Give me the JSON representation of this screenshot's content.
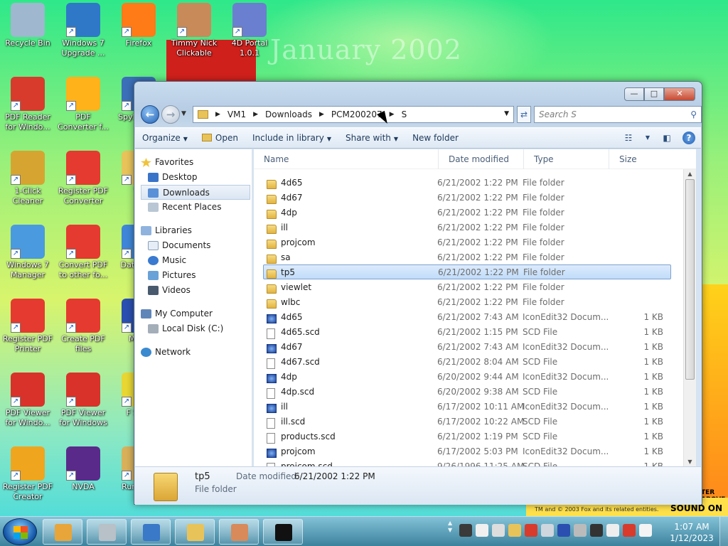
{
  "desktop": {
    "wallpaper_title": "January 2002",
    "icons": [
      {
        "label": "Recycle Bin",
        "icon": "recycle-bin-icon",
        "color": "#9fb7cf"
      },
      {
        "label": "Windows 7 Upgrade ...",
        "icon": "windows-upgrade-icon",
        "color": "#2f78c8"
      },
      {
        "label": "Firefox",
        "icon": "firefox-icon",
        "color": "#ff7b18"
      },
      {
        "label": "Timmy Nick Clickable",
        "icon": "cartoon-character-icon",
        "color": "#c98a5a"
      },
      {
        "label": "4D Portal 1.0.1",
        "icon": "4d-portal-icon",
        "color": "#6b7fd0"
      },
      {
        "label": "PDF Reader for Windo...",
        "icon": "pdf-reader-icon",
        "color": "#d83b2c"
      },
      {
        "label": "PDF Converter f...",
        "icon": "pdf-converter-icon",
        "color": "#ffb21a"
      },
      {
        "label": "Spyb Start",
        "icon": "spybot-icon",
        "color": "#3b6fb8"
      },
      {
        "label": "1-Click Cleaner",
        "icon": "cleaner-icon",
        "color": "#d6a531"
      },
      {
        "label": "Register PDF Converter",
        "icon": "chrome-icon",
        "color": "#e53a2f"
      },
      {
        "label": "Wi",
        "icon": "folder-icon",
        "color": "#e8c35a"
      },
      {
        "label": "Windows 7 Manager",
        "icon": "windows-manager-icon",
        "color": "#4a9ae0"
      },
      {
        "label": "Convert PDF to other fo...",
        "icon": "chrome-icon",
        "color": "#e53a2f"
      },
      {
        "label": "Dat Wind",
        "icon": "data-icon",
        "color": "#3f86d8"
      },
      {
        "label": "Register PDF Printer",
        "icon": "chrome-icon",
        "color": "#e53a2f"
      },
      {
        "label": "Create PDF files",
        "icon": "chrome-icon",
        "color": "#e53a2f"
      },
      {
        "label": "Malw",
        "icon": "malwarebytes-icon",
        "color": "#2a4fb0"
      },
      {
        "label": "PDF Viewer for Windo...",
        "icon": "pdf-viewer-icon",
        "color": "#d8322a"
      },
      {
        "label": "PDF Viewer for Windows",
        "icon": "pdf-viewer-icon",
        "color": "#d8322a"
      },
      {
        "label": "F Spor",
        "icon": "sponge-icon",
        "color": "#e8d632"
      },
      {
        "label": "Register PDF Creator",
        "icon": "cart-icon",
        "color": "#f0a51e"
      },
      {
        "label": "NVDA",
        "icon": "nvda-icon",
        "color": "#5a2a8a"
      },
      {
        "label": "Run Cott",
        "icon": "run-icon",
        "color": "#d9b05a"
      }
    ],
    "wallpaper_footer": "TM and © 2003 Fox and its related entities.",
    "wallpaper_sound": "SOUND ON",
    "wallpaper_side": "TER ABOVE"
  },
  "window": {
    "caption_buttons": {
      "minimize": "—",
      "maximize": "□",
      "close": "✕"
    },
    "address": {
      "segments": [
        "VM1",
        "Downloads",
        "PCM200207",
        "S"
      ]
    },
    "search_placeholder": "Search S",
    "toolbar": {
      "organize": "Organize",
      "open": "Open",
      "include": "Include in library",
      "share": "Share with",
      "new_folder": "New folder"
    },
    "nav": {
      "favorites": "Favorites",
      "desktop": "Desktop",
      "downloads": "Downloads",
      "recent": "Recent Places",
      "libraries": "Libraries",
      "documents": "Documents",
      "music": "Music",
      "pictures": "Pictures",
      "videos": "Videos",
      "computer": "My Computer",
      "local_disk": "Local Disk (C:)",
      "network": "Network"
    },
    "columns": {
      "name": "Name",
      "date": "Date modified",
      "type": "Type",
      "size": "Size"
    },
    "files": [
      {
        "name": "4d65",
        "date": "6/21/2002 1:22 PM",
        "type": "File folder",
        "size": "",
        "kind": "folder"
      },
      {
        "name": "4d67",
        "date": "6/21/2002 1:22 PM",
        "type": "File folder",
        "size": "",
        "kind": "folder"
      },
      {
        "name": "4dp",
        "date": "6/21/2002 1:22 PM",
        "type": "File folder",
        "size": "",
        "kind": "folder"
      },
      {
        "name": "ill",
        "date": "6/21/2002 1:22 PM",
        "type": "File folder",
        "size": "",
        "kind": "folder"
      },
      {
        "name": "projcom",
        "date": "6/21/2002 1:22 PM",
        "type": "File folder",
        "size": "",
        "kind": "folder"
      },
      {
        "name": "sa",
        "date": "6/21/2002 1:22 PM",
        "type": "File folder",
        "size": "",
        "kind": "folder"
      },
      {
        "name": "tp5",
        "date": "6/21/2002 1:22 PM",
        "type": "File folder",
        "size": "",
        "kind": "folder"
      },
      {
        "name": "viewlet",
        "date": "6/21/2002 1:22 PM",
        "type": "File folder",
        "size": "",
        "kind": "folder"
      },
      {
        "name": "wlbc",
        "date": "6/21/2002 1:22 PM",
        "type": "File folder",
        "size": "",
        "kind": "folder"
      },
      {
        "name": "4d65",
        "date": "6/21/2002 7:43 AM",
        "type": "IconEdit32 Docum...",
        "size": "1 KB",
        "kind": "icon"
      },
      {
        "name": "4d65.scd",
        "date": "6/21/2002 1:15 PM",
        "type": "SCD File",
        "size": "1 KB",
        "kind": "doc"
      },
      {
        "name": "4d67",
        "date": "6/21/2002 7:43 AM",
        "type": "IconEdit32 Docum...",
        "size": "1 KB",
        "kind": "icon"
      },
      {
        "name": "4d67.scd",
        "date": "6/21/2002 8:04 AM",
        "type": "SCD File",
        "size": "1 KB",
        "kind": "doc"
      },
      {
        "name": "4dp",
        "date": "6/20/2002 9:44 AM",
        "type": "IconEdit32 Docum...",
        "size": "1 KB",
        "kind": "icon"
      },
      {
        "name": "4dp.scd",
        "date": "6/20/2002 9:38 AM",
        "type": "SCD File",
        "size": "1 KB",
        "kind": "doc"
      },
      {
        "name": "ill",
        "date": "6/17/2002 10:11 AM",
        "type": "IconEdit32 Docum...",
        "size": "1 KB",
        "kind": "icon"
      },
      {
        "name": "ill.scd",
        "date": "6/17/2002 10:22 AM",
        "type": "SCD File",
        "size": "1 KB",
        "kind": "doc"
      },
      {
        "name": "products.scd",
        "date": "6/21/2002 1:19 PM",
        "type": "SCD File",
        "size": "1 KB",
        "kind": "doc"
      },
      {
        "name": "projcom",
        "date": "6/17/2002 5:03 PM",
        "type": "IconEdit32 Docum...",
        "size": "1 KB",
        "kind": "icon"
      },
      {
        "name": "projcom.scd",
        "date": "9/26/1996 11:25 AM",
        "type": "SCD File",
        "size": "1 KB",
        "kind": "doc"
      }
    ],
    "selected_index": 6,
    "details": {
      "name": "tp5",
      "date_label": "Date modified:",
      "date": "6/21/2002 1:22 PM",
      "type": "File folder"
    }
  },
  "taskbar": {
    "clock_time": "1:07 AM",
    "clock_date": "1/12/2023",
    "apps": [
      {
        "icon": "paint-icon",
        "color": "#e8a53a"
      },
      {
        "icon": "key-icon",
        "color": "#b8c0c8"
      },
      {
        "icon": "toolbox-icon",
        "color": "#3a78c8"
      },
      {
        "icon": "folder-icon",
        "color": "#e8c35a"
      },
      {
        "icon": "people-icon",
        "color": "#d88a5a"
      },
      {
        "icon": "7zip-icon",
        "color": "#111111"
      }
    ]
  }
}
